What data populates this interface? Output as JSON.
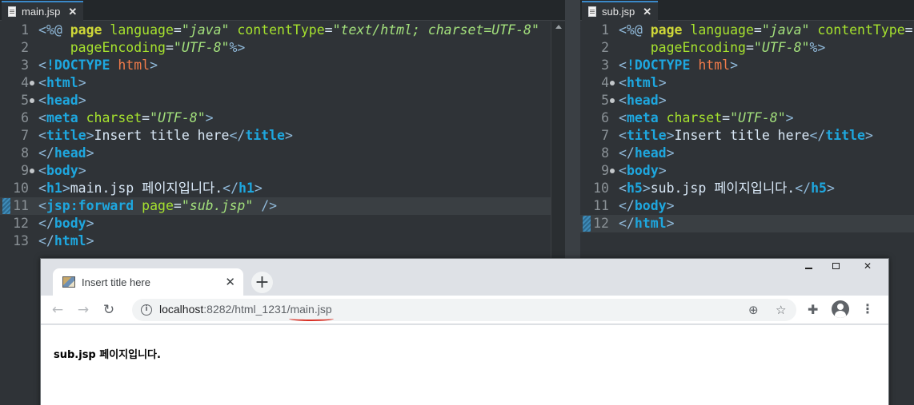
{
  "editor_left": {
    "tab_label": "main.jsp",
    "lines": [
      {
        "n": "1",
        "fold": false,
        "current": false,
        "tokens": [
          [
            "delim",
            "<%@ "
          ],
          [
            "dir",
            "page "
          ],
          [
            "attr",
            "language"
          ],
          [
            "text",
            "="
          ],
          [
            "str",
            "\"java\""
          ],
          [
            "text",
            " "
          ],
          [
            "attr",
            "contentType"
          ],
          [
            "text",
            "="
          ],
          [
            "str",
            "\"text/html; charset=UTF-8\""
          ]
        ]
      },
      {
        "n": "2",
        "fold": false,
        "current": false,
        "tokens": [
          [
            "text",
            "    "
          ],
          [
            "attr",
            "pageEncoding"
          ],
          [
            "text",
            "="
          ],
          [
            "str",
            "\"UTF-8\""
          ],
          [
            "delim",
            "%>"
          ]
        ]
      },
      {
        "n": "3",
        "fold": false,
        "current": false,
        "tokens": [
          [
            "delim",
            "<"
          ],
          [
            "tag",
            "!DOCTYPE"
          ],
          [
            "text",
            " "
          ],
          [
            "doc",
            "html"
          ],
          [
            "delim",
            ">"
          ]
        ]
      },
      {
        "n": "4",
        "fold": true,
        "current": false,
        "tokens": [
          [
            "delim",
            "<"
          ],
          [
            "tag",
            "html"
          ],
          [
            "delim",
            ">"
          ]
        ]
      },
      {
        "n": "5",
        "fold": true,
        "current": false,
        "tokens": [
          [
            "delim",
            "<"
          ],
          [
            "tag",
            "head"
          ],
          [
            "delim",
            ">"
          ]
        ]
      },
      {
        "n": "6",
        "fold": false,
        "current": false,
        "tokens": [
          [
            "delim",
            "<"
          ],
          [
            "tag",
            "meta"
          ],
          [
            "text",
            " "
          ],
          [
            "attr",
            "charset"
          ],
          [
            "text",
            "="
          ],
          [
            "str",
            "\"UTF-8\""
          ],
          [
            "delim",
            ">"
          ]
        ]
      },
      {
        "n": "7",
        "fold": false,
        "current": false,
        "tokens": [
          [
            "delim",
            "<"
          ],
          [
            "tag",
            "title"
          ],
          [
            "delim",
            ">"
          ],
          [
            "text",
            "Insert title here"
          ],
          [
            "delim",
            "</"
          ],
          [
            "tag",
            "title"
          ],
          [
            "delim",
            ">"
          ]
        ]
      },
      {
        "n": "8",
        "fold": false,
        "current": false,
        "tokens": [
          [
            "delim",
            "</"
          ],
          [
            "tag",
            "head"
          ],
          [
            "delim",
            ">"
          ]
        ]
      },
      {
        "n": "9",
        "fold": true,
        "current": false,
        "tokens": [
          [
            "delim",
            "<"
          ],
          [
            "tag",
            "body"
          ],
          [
            "delim",
            ">"
          ]
        ]
      },
      {
        "n": "10",
        "fold": false,
        "current": false,
        "tokens": [
          [
            "delim",
            "<"
          ],
          [
            "tag",
            "h1"
          ],
          [
            "delim",
            ">"
          ],
          [
            "text",
            "main.jsp 페이지입니다."
          ],
          [
            "delim",
            "</"
          ],
          [
            "tag",
            "h1"
          ],
          [
            "delim",
            ">"
          ]
        ]
      },
      {
        "n": "11",
        "fold": false,
        "current": true,
        "tokens": [
          [
            "delim",
            "<"
          ],
          [
            "tag",
            "jsp:forward"
          ],
          [
            "text",
            " "
          ],
          [
            "attr",
            "page"
          ],
          [
            "text",
            "="
          ],
          [
            "str",
            "\"sub.jsp\""
          ],
          [
            "text",
            " "
          ],
          [
            "delim",
            "/>"
          ]
        ]
      },
      {
        "n": "12",
        "fold": false,
        "current": false,
        "tokens": [
          [
            "delim",
            "</"
          ],
          [
            "tag",
            "body"
          ],
          [
            "delim",
            ">"
          ]
        ]
      },
      {
        "n": "13",
        "fold": false,
        "current": false,
        "tokens": [
          [
            "delim",
            "</"
          ],
          [
            "tag",
            "html"
          ],
          [
            "delim",
            ">"
          ]
        ]
      }
    ]
  },
  "editor_right": {
    "tab_label": "sub.jsp",
    "lines": [
      {
        "n": "1",
        "fold": false,
        "current": false,
        "tokens": [
          [
            "delim",
            "<%@ "
          ],
          [
            "dir",
            "page "
          ],
          [
            "attr",
            "language"
          ],
          [
            "text",
            "="
          ],
          [
            "str",
            "\"java\""
          ],
          [
            "text",
            " "
          ],
          [
            "attr",
            "contentType"
          ],
          [
            "text",
            "="
          ]
        ]
      },
      {
        "n": "2",
        "fold": false,
        "current": false,
        "tokens": [
          [
            "text",
            "    "
          ],
          [
            "attr",
            "pageEncoding"
          ],
          [
            "text",
            "="
          ],
          [
            "str",
            "\"UTF-8\""
          ],
          [
            "delim",
            "%>"
          ]
        ]
      },
      {
        "n": "3",
        "fold": false,
        "current": false,
        "tokens": [
          [
            "delim",
            "<"
          ],
          [
            "tag",
            "!DOCTYPE"
          ],
          [
            "text",
            " "
          ],
          [
            "doc",
            "html"
          ],
          [
            "delim",
            ">"
          ]
        ]
      },
      {
        "n": "4",
        "fold": true,
        "current": false,
        "tokens": [
          [
            "delim",
            "<"
          ],
          [
            "tag",
            "html"
          ],
          [
            "delim",
            ">"
          ]
        ]
      },
      {
        "n": "5",
        "fold": true,
        "current": false,
        "tokens": [
          [
            "delim",
            "<"
          ],
          [
            "tag",
            "head"
          ],
          [
            "delim",
            ">"
          ]
        ]
      },
      {
        "n": "6",
        "fold": false,
        "current": false,
        "tokens": [
          [
            "delim",
            "<"
          ],
          [
            "tag",
            "meta"
          ],
          [
            "text",
            " "
          ],
          [
            "attr",
            "charset"
          ],
          [
            "text",
            "="
          ],
          [
            "str",
            "\"UTF-8\""
          ],
          [
            "delim",
            ">"
          ]
        ]
      },
      {
        "n": "7",
        "fold": false,
        "current": false,
        "tokens": [
          [
            "delim",
            "<"
          ],
          [
            "tag",
            "title"
          ],
          [
            "delim",
            ">"
          ],
          [
            "text",
            "Insert title here"
          ],
          [
            "delim",
            "</"
          ],
          [
            "tag",
            "title"
          ],
          [
            "delim",
            ">"
          ]
        ]
      },
      {
        "n": "8",
        "fold": false,
        "current": false,
        "tokens": [
          [
            "delim",
            "</"
          ],
          [
            "tag",
            "head"
          ],
          [
            "delim",
            ">"
          ]
        ]
      },
      {
        "n": "9",
        "fold": true,
        "current": false,
        "tokens": [
          [
            "delim",
            "<"
          ],
          [
            "tag",
            "body"
          ],
          [
            "delim",
            ">"
          ]
        ]
      },
      {
        "n": "10",
        "fold": false,
        "current": false,
        "tokens": [
          [
            "delim",
            "<"
          ],
          [
            "tag",
            "h5"
          ],
          [
            "delim",
            ">"
          ],
          [
            "text",
            "sub.jsp 페이지입니다."
          ],
          [
            "delim",
            "</"
          ],
          [
            "tag",
            "h5"
          ],
          [
            "delim",
            ">"
          ]
        ]
      },
      {
        "n": "11",
        "fold": false,
        "current": false,
        "tokens": [
          [
            "delim",
            "</"
          ],
          [
            "tag",
            "body"
          ],
          [
            "delim",
            ">"
          ]
        ]
      },
      {
        "n": "12",
        "fold": false,
        "current": true,
        "tokens": [
          [
            "delim",
            "</"
          ],
          [
            "tag",
            "html"
          ],
          [
            "delim",
            ">"
          ]
        ]
      }
    ]
  },
  "browser": {
    "tab_title": "Insert title here",
    "tab_close": "✕",
    "new_tab": "+",
    "url_host": "localhost",
    "url_rest": ":8282/html_1231/",
    "url_file": "main.jsp",
    "page_heading": "sub.jsp 페이지입니다.",
    "icons": {
      "back": "←",
      "forward": "→",
      "reload": "↻",
      "info": "i",
      "zoom": "⊕",
      "star": "☆",
      "extensions": "✚",
      "menu": "⋮",
      "win_close": "✕"
    }
  }
}
